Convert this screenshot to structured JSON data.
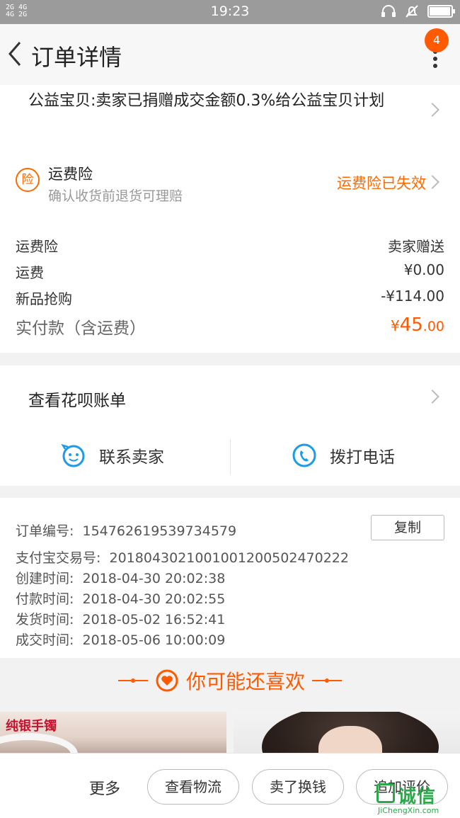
{
  "status_bar": {
    "time": "19:23",
    "signal_left": "2G 4G",
    "signal_right": "4G 2G"
  },
  "header": {
    "title": "订单详情",
    "badge_count": "4"
  },
  "charity": {
    "text": "公益宝贝:卖家已捐赠成交金额0.3%给公益宝贝计划"
  },
  "shipping_insurance": {
    "icon_char": "险",
    "title": "运费险",
    "subtitle": "确认收货前退货可理赔",
    "status": "运费险已失效"
  },
  "fees": [
    {
      "label": "运费险",
      "value": "卖家赠送"
    },
    {
      "label": "运费",
      "value": "¥0.00"
    },
    {
      "label": "新品抢购",
      "value": "-¥114.00"
    }
  ],
  "payment": {
    "label": "实付款（含运费）",
    "currency": "¥",
    "integer": "45",
    "decimal": ".00"
  },
  "huabei": {
    "label": "查看花呗账单"
  },
  "contact": {
    "seller_label": "联系卖家",
    "phone_label": "拨打电话"
  },
  "order_info": {
    "copy_label": "复制",
    "lines": [
      {
        "label": "订单编号:",
        "value": "154762619539734579"
      },
      {
        "label": "支付宝交易号:",
        "value": "2018043021001001200502470222"
      },
      {
        "label": "创建时间:",
        "value": "2018-04-30 20:02:38"
      },
      {
        "label": "付款时间:",
        "value": "2018-04-30 20:02:55"
      },
      {
        "label": "发货时间:",
        "value": "2018-05-02 16:52:41"
      },
      {
        "label": "成交时间:",
        "value": "2018-05-06 10:00:09"
      }
    ]
  },
  "recommend": {
    "title": "你可能还喜欢"
  },
  "products": [
    {
      "tag": "纯银手镯"
    }
  ],
  "bottom_bar": {
    "more_label": "更多",
    "buttons": [
      "查看物流",
      "卖了换钱",
      "追加评价"
    ]
  },
  "watermark": {
    "text": "诚信",
    "url_text": "JiChengXin.com"
  },
  "colors": {
    "accent": "#ff5a00",
    "link_blue": "#1e9be6",
    "status_bar": "#9b9b9b"
  },
  "battery_level": 0.9
}
